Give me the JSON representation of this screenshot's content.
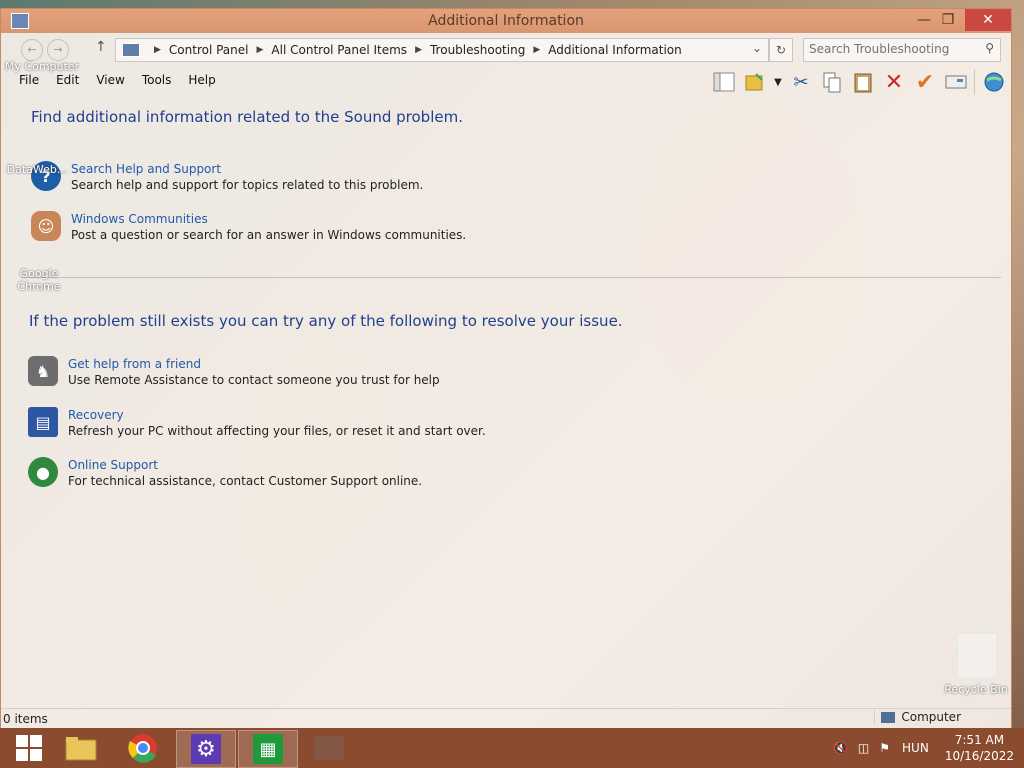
{
  "window": {
    "title": "Additional Information"
  },
  "address": {
    "crumbs": [
      "Control Panel",
      "All Control Panel Items",
      "Troubleshooting",
      "Additional Information"
    ],
    "search_placeholder": "Search Troubleshooting"
  },
  "menu": [
    "File",
    "Edit",
    "View",
    "Tools",
    "Help"
  ],
  "toolbar_icons": [
    "layout-icon",
    "folder-options-icon",
    "cut-icon",
    "copy-icon",
    "paste-icon",
    "delete-icon",
    "check-icon",
    "properties-icon",
    "globe-icon"
  ],
  "section1": {
    "heading": "Find additional information related to the Sound problem.",
    "items": [
      {
        "title": "Search Help and Support",
        "desc": "Search help and support for topics related to this problem."
      },
      {
        "title": "Windows Communities",
        "desc": "Post a question or search for an answer in Windows communities."
      }
    ]
  },
  "section2": {
    "heading": "If the problem still exists you can try any of the following to resolve your issue.",
    "items": [
      {
        "title": "Get help from a friend",
        "desc": "Use Remote Assistance to contact someone you trust for help"
      },
      {
        "title": "Recovery",
        "desc": "Refresh your PC without affecting your files, or reset it and start over."
      },
      {
        "title": "Online Support",
        "desc": "For technical assistance, contact Customer Support online."
      }
    ]
  },
  "status": {
    "items_count": "0 items",
    "zone": "Computer"
  },
  "desktop": {
    "icons": [
      "My Computer",
      "DataWeb...",
      "Google Chrome",
      "Recycle Bin"
    ]
  },
  "taskbar": {
    "tray": {
      "language": "HUN",
      "time": "7:51 AM",
      "date": "10/16/2022"
    }
  },
  "colors": {
    "titlebar": "#d99670",
    "taskbar": "#8a4b2e",
    "heading": "#1f3f8f",
    "link": "#1f5aa8"
  }
}
